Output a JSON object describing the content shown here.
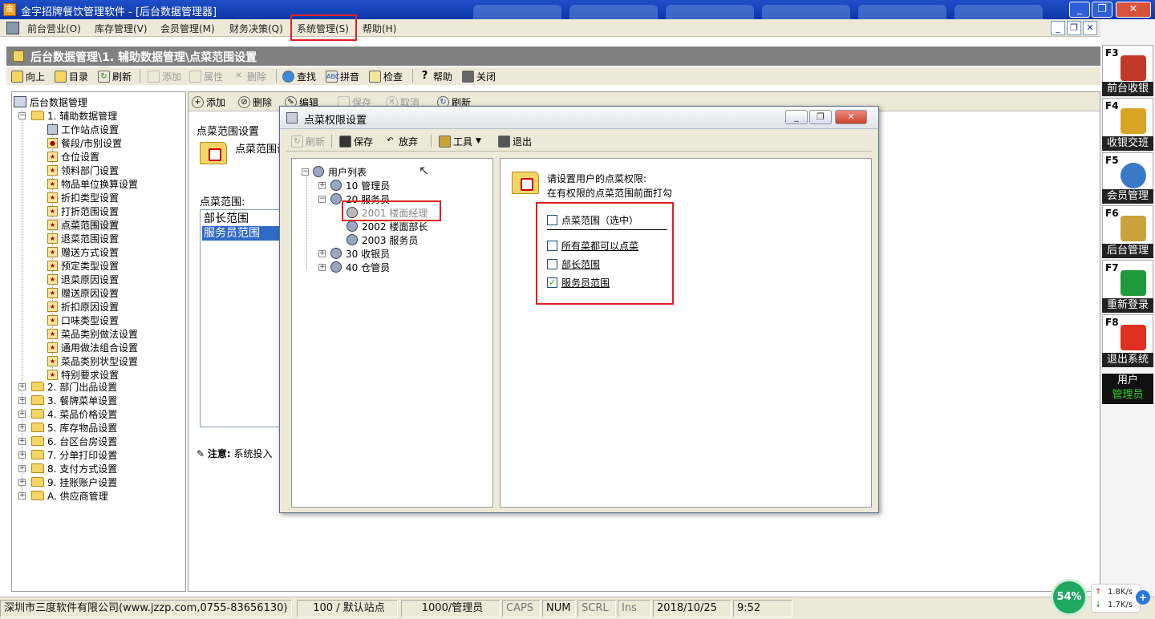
{
  "window": {
    "title": "金字招牌餐饮管理软件 - [后台数据管理器]",
    "min": "_",
    "restore": "❐",
    "close": "✕"
  },
  "menu": {
    "items": [
      "前台营业(O)",
      "库存管理(V)",
      "会员管理(M)",
      "财务决策(Q)",
      "系统管理(S)",
      "帮助(H)"
    ],
    "mdi_min": "_",
    "mdi_restore": "❐",
    "mdi_close": "✕"
  },
  "breadcrumb": "后台数据管理\\1. 辅助数据管理\\点菜范围设置",
  "toolbar": {
    "up": "向上",
    "catalog": "目录",
    "refresh": "刷新",
    "add": "添加",
    "props": "属性",
    "delete": "删除",
    "find": "查找",
    "pinyin": "拼音",
    "check": "检查",
    "help": "帮助",
    "close": "关闭"
  },
  "tree": {
    "root": "后台数据管理",
    "group1": "1. 辅助数据管理",
    "children": [
      "工作站点设置",
      "餐段/市别设置",
      "仓位设置",
      "领料部门设置",
      "物品单位换算设置",
      "折扣类型设置",
      "打折范围设置",
      "点菜范围设置",
      "退菜范围设置",
      "赠送方式设置",
      "预定类型设置",
      "退菜原因设置",
      "赠送原因设置",
      "折扣原因设置",
      "口味类型设置",
      "菜品类别做法设置",
      "通用做法组合设置",
      "菜品类别状型设置",
      "特别要求设置"
    ],
    "groups": [
      "2. 部门出品设置",
      "3. 餐牌菜单设置",
      "4. 菜品价格设置",
      "5. 库存物品设置",
      "6. 台区台房设置",
      "7. 分单打印设置",
      "8. 支付方式设置",
      "9. 挂账账户设置",
      "A. 供应商管理"
    ]
  },
  "content": {
    "toolbar": {
      "add": "添加",
      "delete": "删除",
      "edit": "编辑",
      "save": "保存",
      "cancel": "取消",
      "refresh": "刷新"
    },
    "section_title": "点菜范围设置",
    "folder_caption": "点菜范围设",
    "list_label": "点菜范围:",
    "list_items": [
      "部长范围",
      "服务员范围"
    ],
    "note_label": "注意:",
    "note_text": "系统投入"
  },
  "dialog": {
    "title": "点菜权限设置",
    "toolbar": {
      "refresh": "刷新",
      "save": "保存",
      "discard": "放弃",
      "tools": "工具",
      "exit": "退出"
    },
    "tree": {
      "root": "用户列表",
      "nodes": [
        "10 管理员",
        "20 服务员",
        "2001 楼面经理",
        "2002 楼面部长",
        "2003 服务员",
        "30 收银员",
        "40 仓管员"
      ]
    },
    "prompt_line1": "请设置用户的点菜权限:",
    "prompt_line2": "在有权限的点菜范围前面打勾",
    "checks": [
      {
        "label": "点菜范围（选中）",
        "checked": false
      },
      {
        "label": "所有菜都可以点菜",
        "checked": false
      },
      {
        "label": "部长范围",
        "checked": false
      },
      {
        "label": "服务员范围",
        "checked": true
      }
    ],
    "check_mark": "✓",
    "min": "_",
    "restore": "❐",
    "close": "✕"
  },
  "sidebar": {
    "keys": [
      {
        "key": "F3",
        "label": "前台收银",
        "color": "#c0392b"
      },
      {
        "key": "F4",
        "label": "收银交班",
        "color": "#d9a424"
      },
      {
        "key": "F5",
        "label": "会员管理",
        "color": "#3a78c8"
      },
      {
        "key": "F6",
        "label": "后台管理",
        "color": "#caa33a"
      },
      {
        "key": "F7",
        "label": "重新登录",
        "color": "#1f9a3a"
      },
      {
        "key": "F8",
        "label": "退出系统",
        "color": "#e03020"
      }
    ],
    "user_label": "用户",
    "user_name": "管理员"
  },
  "status": {
    "company": "深圳市三度软件有限公司(www.jzzp.com,0755-83656130)",
    "station": "100 / 默认站点",
    "operator": "1000/管理员",
    "caps": "CAPS",
    "num": "NUM",
    "scrl": "SCRL",
    "ins": "Ins",
    "date": "2018/10/25",
    "time": "9:52"
  },
  "net": {
    "percent": "54%",
    "up_arrow": "↑",
    "down_arrow": "↓",
    "up": "1.8K/s",
    "down": "1.7K/s",
    "plus": "+"
  }
}
